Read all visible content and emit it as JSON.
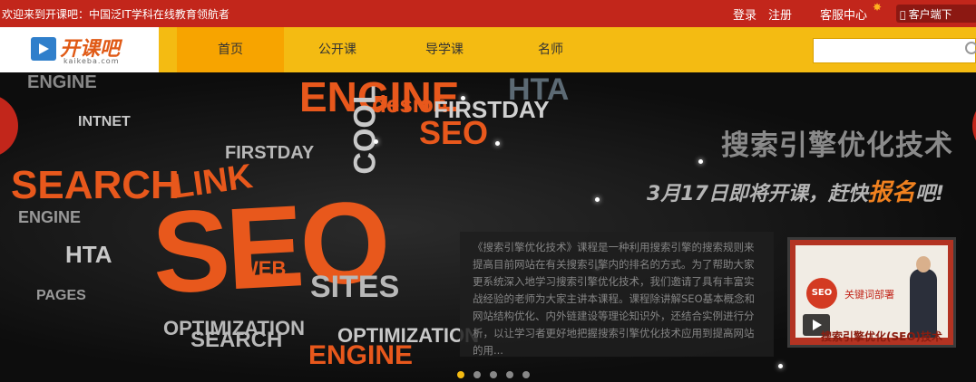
{
  "topbar": {
    "welcome": "欢迎来到开课吧：中国泛IT学科在线教育领航者",
    "login": "登录",
    "register": "注册",
    "service": "客服中心",
    "client_os": "",
    "client": "客户端下"
  },
  "logo": {
    "text": "开课吧",
    "sub": "kaikeba.com"
  },
  "nav": {
    "items": [
      "首页",
      "公开课",
      "导学课",
      "名师"
    ]
  },
  "search": {
    "placeholder": ""
  },
  "banner": {
    "title": "搜索引擎优化技术",
    "sub_prefix": "3月17日即将开课，赶快",
    "sub_highlight": "报名",
    "sub_suffix": "吧!",
    "description": "《搜索引擎优化技术》课程是一种利用搜索引擎的搜索规则来提高目前网站在有关搜索引擎内的排名的方式。为了帮助大家更系统深入地学习搜索引擎优化技术，我们邀请了具有丰富实战经验的老师为大家主讲本课程。课程除讲解SEO基本概念和网站结构优化、内外链建设等理论知识外，还结合实例进行分析，以让学习者更好地把握搜索引擎优化技术应用到提高网站的用...",
    "video": {
      "badge": "SEO",
      "keyword": "关键词部署",
      "caption": "搜索引擎优化(SEO)技术"
    },
    "words": {
      "seo_big": "SEO",
      "search": "SEARCH",
      "engine1": "ENGINE",
      "hta": "HTA",
      "desion": "desion",
      "firstday": "FIRSTDAY",
      "seo2": "SEO",
      "link": "LINK",
      "firstday2": "FIRSTDAY",
      "sites": "SITES",
      "engine2": "ENGINE",
      "optim": "OPTIMIZATION",
      "web": "WEB",
      "engine3": "ENGINE",
      "intnet": "INTNET",
      "hta2": "HTA",
      "search2": "SEARCH",
      "optim2": "OPTIMIZATION",
      "engine4": "ENGINE",
      "cool": "COOL",
      "pages": "PAGES"
    },
    "slide_count": 5,
    "active_slide": 1
  }
}
